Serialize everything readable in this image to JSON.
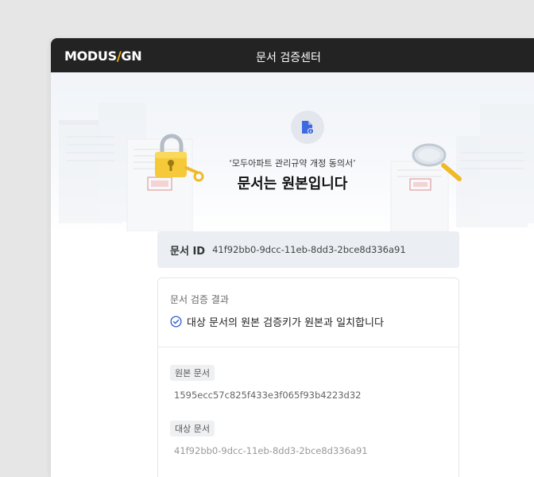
{
  "header": {
    "logo_part1": "MODUS",
    "logo_slash": "/",
    "logo_part2": "GN",
    "title": "문서 검증센터"
  },
  "hero": {
    "icon": "document-info-icon",
    "subtitle": "‘모두아파트 관리규약 개정 동의서’",
    "title": "문서는 원본입니다"
  },
  "document_id": {
    "label": "문서 ID",
    "value": "41f92bb0-9dcc-11eb-8dd3-2bce8d336a91"
  },
  "verification": {
    "section_title": "문서 검증 결과",
    "result_icon": "check-circle-icon",
    "result_text": "대상 문서의 원본 검증키가 원본과 일치합니다",
    "original_label": "원본 문서",
    "original_hash": "1595ecc57c825f433e3f065f93b4223d32",
    "target_label": "대상 문서",
    "target_hash": "41f92bb0-9dcc-11eb-8dd3-2bce8d336a91"
  },
  "colors": {
    "accent": "#f5b800",
    "header_bg": "#232323",
    "check": "#2f5bd3"
  }
}
